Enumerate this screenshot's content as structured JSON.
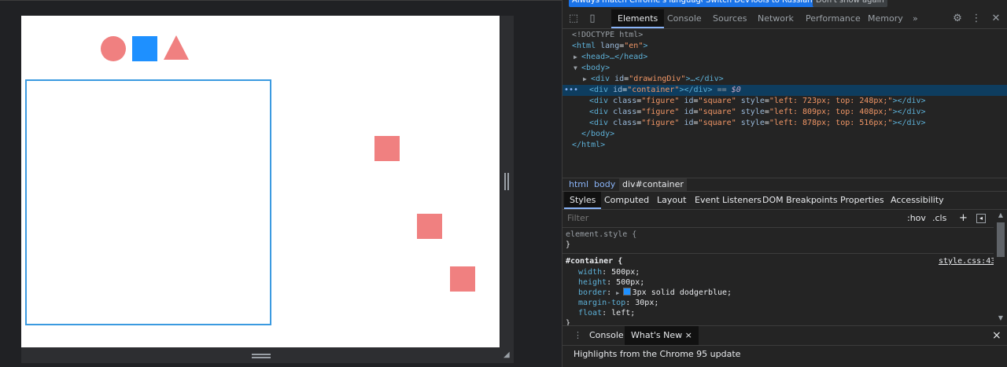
{
  "page": {
    "shapes_toolbar": [
      "circle",
      "square",
      "triangle"
    ],
    "colors": {
      "figure": "#f08080",
      "square_tool": "#1e90ff",
      "container_border": "#1e90ff",
      "selected_row": "#0e3d5f",
      "accent": "#8ab4f8"
    }
  },
  "devtools": {
    "lang_bar": {
      "btn1": "Always match Chrome's language",
      "btn2": "Switch DevTools to Russian",
      "btn3": "Don't show again"
    },
    "icons": {
      "inspect": "inspect-icon",
      "device": "device-toggle-icon",
      "more_tabs": "chevrons-icon",
      "settings": "gear-icon",
      "menu": "kebab-icon",
      "close": "close-icon"
    },
    "tabs": [
      "Elements",
      "Console",
      "Sources",
      "Network",
      "Performance",
      "Memory"
    ],
    "more_tabs": "»",
    "dom": {
      "doctype": "<!DOCTYPE html>",
      "html_open": {
        "tag": "<html",
        "attr": "lang",
        "val": "\"en\"",
        "end": ">"
      },
      "head": {
        "text": "<head>…</head>"
      },
      "body_open": "<body>",
      "drawing": {
        "tag": "<div",
        "attr": "id",
        "val": "\"drawingDiv\"",
        "end": ">…</div>"
      },
      "container": {
        "tag": "<div",
        "attr": "id",
        "val": "\"container\"",
        "end": "></div>",
        "suffix": " == ",
        "var": "$0"
      },
      "figures": [
        {
          "class_val": "\"figure\"",
          "id_val": "\"square\"",
          "style_val": "\"left: 723px; top: 248px;\""
        },
        {
          "class_val": "\"figure\"",
          "id_val": "\"square\"",
          "style_val": "\"left: 809px; top: 408px;\""
        },
        {
          "class_val": "\"figure\"",
          "id_val": "\"square\"",
          "style_val": "\"left: 878px; top: 516px;\""
        }
      ],
      "body_close": "</body>",
      "html_close": "</html>",
      "attr_names": {
        "class": "class",
        "id": "id",
        "style": "style"
      },
      "div_open": "<div",
      "div_close": "></div>",
      "more_dots": "•••"
    },
    "breadcrumbs": [
      "html",
      "body",
      "div#container"
    ],
    "subtabs": [
      "Styles",
      "Computed",
      "Layout",
      "Event Listeners",
      "DOM Breakpoints",
      "Properties",
      "Accessibility"
    ],
    "filter": {
      "placeholder": "Filter",
      "hov": ":hov",
      "cls": ".cls",
      "plus": "+",
      "toggle": "sidebar-toggle-icon"
    },
    "styles": {
      "element_style": "element.style {",
      "element_close": "}",
      "rule_selector": "#container {",
      "source": "style.css:43",
      "props": [
        {
          "name": "width",
          "value": "500px;"
        },
        {
          "name": "height",
          "value": "500px;"
        },
        {
          "name": "border",
          "value": "3px solid dodgerblue;"
        },
        {
          "name": "margin-top",
          "value": "30px;"
        },
        {
          "name": "float",
          "value": "left;"
        }
      ],
      "rule_close": "}"
    },
    "drawer": {
      "tabs": [
        "Console",
        "What's New"
      ],
      "close_tab": "×",
      "close": "×",
      "highlights": "Highlights from the Chrome 95 update"
    }
  }
}
